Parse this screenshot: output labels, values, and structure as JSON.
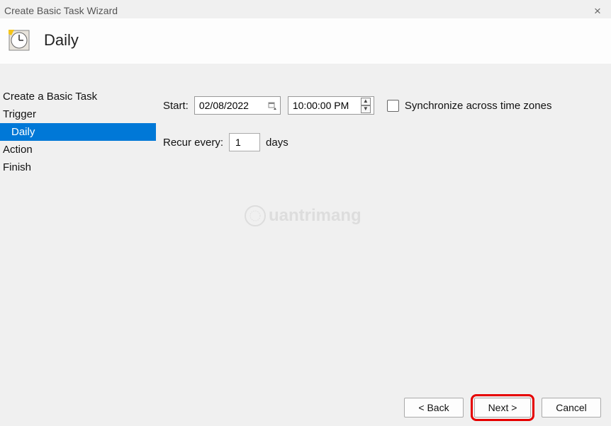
{
  "window": {
    "title": "Create Basic Task Wizard"
  },
  "header": {
    "title": "Daily"
  },
  "sidebar": {
    "items": [
      {
        "label": "Create a Basic Task",
        "selected": false,
        "indent": false
      },
      {
        "label": "Trigger",
        "selected": false,
        "indent": false
      },
      {
        "label": "Daily",
        "selected": true,
        "indent": true
      },
      {
        "label": "Action",
        "selected": false,
        "indent": false
      },
      {
        "label": "Finish",
        "selected": false,
        "indent": false
      }
    ]
  },
  "form": {
    "start_label": "Start:",
    "date_value": "02/08/2022",
    "time_value": "10:00:00 PM",
    "sync_label": "Synchronize across time zones",
    "sync_checked": false,
    "recur_label": "Recur every:",
    "recur_value": "1",
    "recur_unit": "days"
  },
  "footer": {
    "back_label": "< Back",
    "next_label": "Next >",
    "cancel_label": "Cancel"
  },
  "watermark": {
    "text": "uantrimang"
  }
}
